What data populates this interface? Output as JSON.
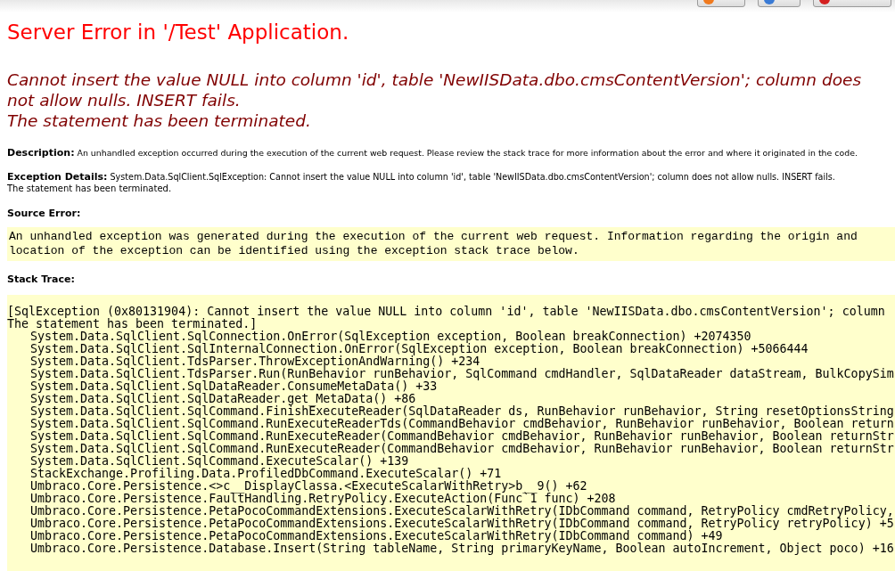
{
  "toolbar_buttons": [
    {
      "color": "#f07a1e"
    },
    {
      "color": "#3a7bd5"
    },
    {
      "color": "#d42020"
    }
  ],
  "title": "Server Error in '/Test' Application.",
  "message": [
    "Cannot insert the value NULL into column 'id', table 'NewIISData.dbo.cmsContentVersion'; column does",
    "not allow nulls. INSERT fails.",
    "The statement has been terminated."
  ],
  "description": {
    "label": "Description:",
    "text": "An unhandled exception occurred during the execution of the current web request. Please review the stack trace for more information about the error and where it originated in the code."
  },
  "exception_details": {
    "label": "Exception Details:",
    "text": "System.Data.SqlClient.SqlException: Cannot insert the value NULL into column 'id', table 'NewIISData.dbo.cmsContentVersion'; column does not allow nulls. INSERT fails.",
    "text_2": "The statement has been terminated."
  },
  "source_error": {
    "heading": "Source Error:",
    "lines": [
      "An unhandled exception was generated during the execution of the current web request. Information regarding the origin and",
      "location of the exception can be identified using the exception stack trace below."
    ]
  },
  "stack_trace": {
    "heading": "Stack Trace:",
    "lines": [
      {
        "kind": "message",
        "text": "[SqlException (0x80131904): Cannot insert the value NULL into column 'id', table 'NewIISData.dbo.cmsContentVersion'; column"
      },
      {
        "kind": "message",
        "text": "The statement has been terminated.]"
      },
      {
        "kind": "frame",
        "text": "System.Data.SqlClient.SqlConnection.OnError(SqlException exception, Boolean breakConnection) +2074350"
      },
      {
        "kind": "frame",
        "text": "System.Data.SqlClient.SqlInternalConnection.OnError(SqlException exception, Boolean breakConnection) +5066444"
      },
      {
        "kind": "frame",
        "text": "System.Data.SqlClient.TdsParser.ThrowExceptionAndWarning() +234"
      },
      {
        "kind": "frame",
        "text": "System.Data.SqlClient.TdsParser.Run(RunBehavior runBehavior, SqlCommand cmdHandler, SqlDataReader dataStream, BulkCopySim"
      },
      {
        "kind": "frame",
        "text": "System.Data.SqlClient.SqlDataReader.ConsumeMetaData() +33"
      },
      {
        "kind": "frame",
        "text": "System.Data.SqlClient.SqlDataReader.get_MetaData() +86"
      },
      {
        "kind": "frame",
        "text": "System.Data.SqlClient.SqlCommand.FinishExecuteReader(SqlDataReader ds, RunBehavior runBehavior, String resetOptionsString"
      },
      {
        "kind": "frame",
        "text": "System.Data.SqlClient.SqlCommand.RunExecuteReaderTds(CommandBehavior cmdBehavior, RunBehavior runBehavior, Boolean return"
      },
      {
        "kind": "frame",
        "text": "System.Data.SqlClient.SqlCommand.RunExecuteReader(CommandBehavior cmdBehavior, RunBehavior runBehavior, Boolean returnStr"
      },
      {
        "kind": "frame",
        "text": "System.Data.SqlClient.SqlCommand.RunExecuteReader(CommandBehavior cmdBehavior, RunBehavior runBehavior, Boolean returnStr"
      },
      {
        "kind": "frame",
        "text": "System.Data.SqlClient.SqlCommand.ExecuteScalar() +139"
      },
      {
        "kind": "frame",
        "text": "StackExchange.Profiling.Data.ProfiledDbCommand.ExecuteScalar() +71"
      },
      {
        "kind": "frame",
        "text": "Umbraco.Core.Persistence.<>c__DisplayClassa.<ExecuteScalarWithRetry>b__9() +62"
      },
      {
        "kind": "frame",
        "text": "Umbraco.Core.Persistence.FaultHandling.RetryPolicy.ExecuteAction(Func`1 func) +208"
      },
      {
        "kind": "frame",
        "text": "Umbraco.Core.Persistence.PetaPocoCommandExtensions.ExecuteScalarWithRetry(IDbCommand command, RetryPolicy cmdRetryPolicy,"
      },
      {
        "kind": "frame",
        "text": "Umbraco.Core.Persistence.PetaPocoCommandExtensions.ExecuteScalarWithRetry(IDbCommand command, RetryPolicy retryPolicy) +5"
      },
      {
        "kind": "frame",
        "text": "Umbraco.Core.Persistence.PetaPocoCommandExtensions.ExecuteScalarWithRetry(IDbCommand command) +49"
      },
      {
        "kind": "frame",
        "text": "Umbraco.Core.Persistence.Database.Insert(String tableName, String primaryKeyName, Boolean autoIncrement, Object poco) +16"
      }
    ]
  }
}
